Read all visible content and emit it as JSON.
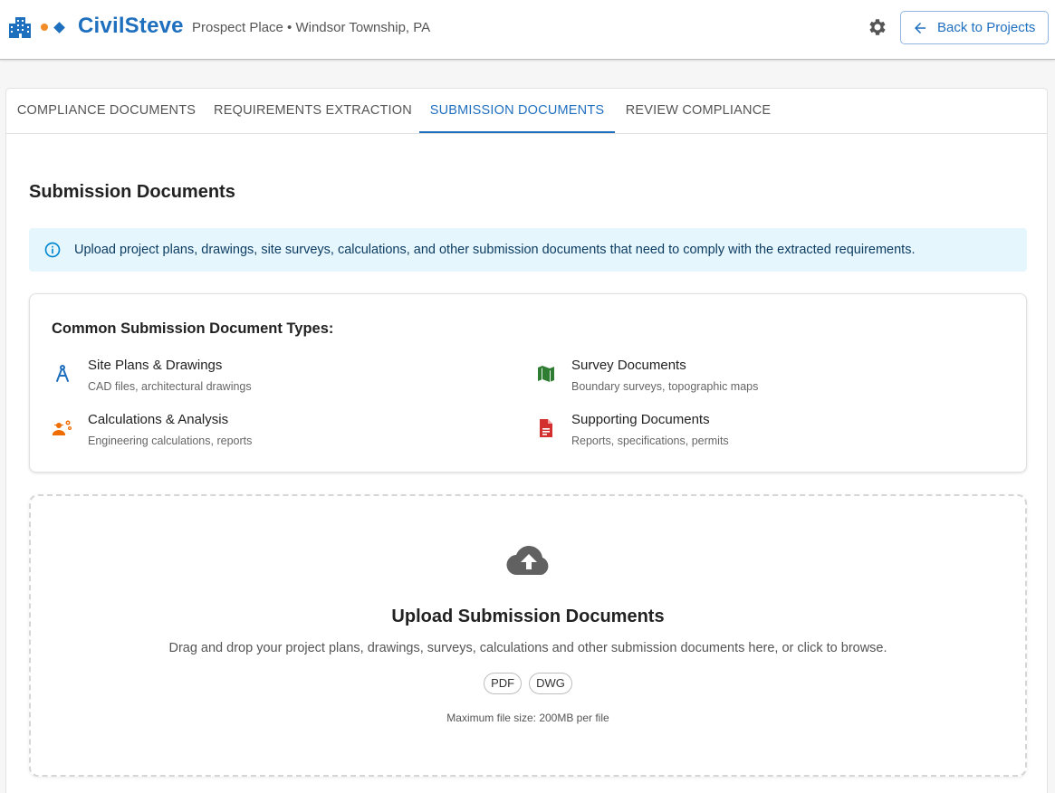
{
  "header": {
    "brand": "CivilSteve",
    "project": "Prospect Place • Windsor Township, PA",
    "back_label": "Back to Projects",
    "colors": {
      "brand": "#1f6fbf",
      "accent_orange": "#f28c28",
      "accent_blue": "#1f6fbf"
    },
    "icons": {
      "logo": "building-icon",
      "settings": "gear-icon",
      "back": "arrow-left-icon"
    }
  },
  "tabs": [
    {
      "label": "COMPLIANCE DOCUMENTS",
      "active": false
    },
    {
      "label": "REQUIREMENTS EXTRACTION",
      "active": false
    },
    {
      "label": "SUBMISSION DOCUMENTS",
      "active": true
    },
    {
      "label": "REVIEW COMPLIANCE",
      "active": false
    }
  ],
  "main": {
    "title": "Submission Documents",
    "info": "Upload project plans, drawings, site surveys, calculations, and other submission documents that need to comply with the extracted requirements.",
    "types": {
      "heading": "Common Submission Document Types:",
      "items": [
        {
          "title": "Site Plans & Drawings",
          "desc": "CAD files, architectural drawings",
          "icon": "drafting-compass-icon",
          "color": "#1f6fbf"
        },
        {
          "title": "Survey Documents",
          "desc": "Boundary surveys, topographic maps",
          "icon": "map-icon",
          "color": "#2e7d32"
        },
        {
          "title": "Calculations & Analysis",
          "desc": "Engineering calculations, reports",
          "icon": "engineering-icon",
          "color": "#ef6c00"
        },
        {
          "title": "Supporting Documents",
          "desc": "Reports, specifications, permits",
          "icon": "document-icon",
          "color": "#d32f2f"
        }
      ]
    },
    "upload": {
      "title": "Upload Submission Documents",
      "subtitle": "Drag and drop your project plans, drawings, surveys, calculations and other submission documents here, or click to browse.",
      "formats": [
        "PDF",
        "DWG"
      ],
      "max_size": "Maximum file size: 200MB per file",
      "icon": "cloud-upload-icon"
    }
  }
}
